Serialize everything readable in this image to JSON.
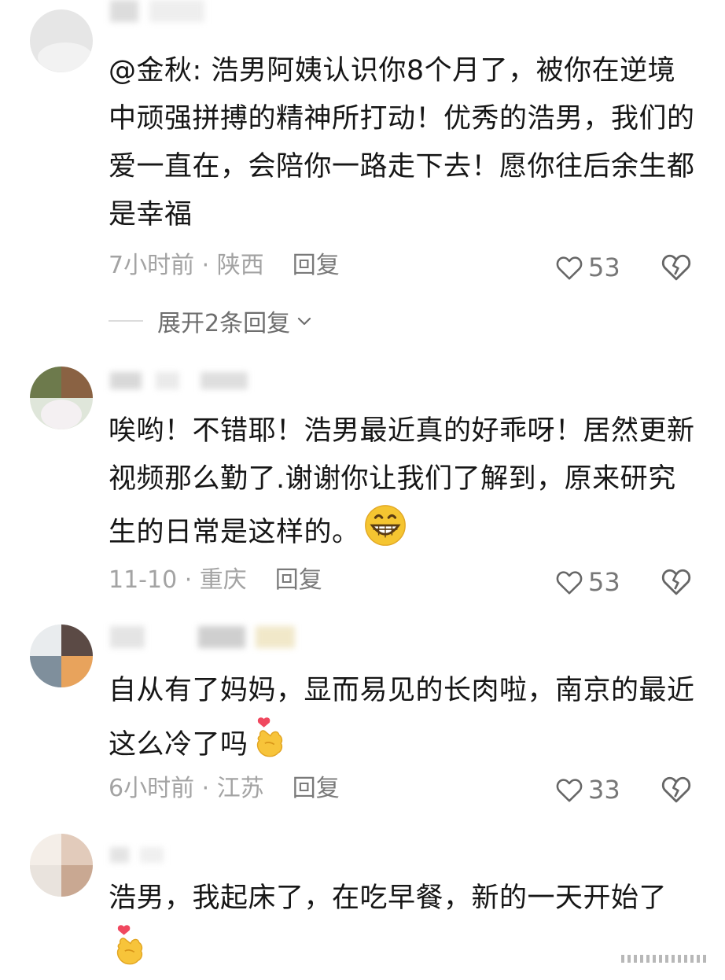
{
  "comments": [
    {
      "username": "",
      "text": "@金秋: 浩男阿姨认识你8个月了，被你在逆境中顽强拼搏的精神所打动！优秀的浩男，我们的爱一直在，会陪你一路走下去！愿你往后余生都是幸福",
      "meta": "7小时前 · 陕西",
      "reply_label": "回复",
      "likes": "53",
      "expand_label": "展开2条回复"
    },
    {
      "username": "",
      "text": "唉哟！不错耶！浩男最近真的好乖呀！居然更新视频那么勤了.谢谢你让我们了解到，原来研究生的日常是这样的。",
      "meta": "11-10 · 重庆",
      "reply_label": "回复",
      "likes": "53"
    },
    {
      "username": "",
      "text": "自从有了妈妈，显而易见的长肉啦，南京的最近这么冷了吗",
      "meta": "6小时前 · 江苏",
      "reply_label": "回复",
      "likes": "33"
    },
    {
      "username": "",
      "text": "浩男，我起床了，在吃早餐，新的一天开始了"
    }
  ],
  "icons": {
    "like": "heart-outline-icon",
    "dislike": "broken-heart-icon",
    "expand": "chevron-down-icon",
    "emoji_grin": "grinning-face-emoji",
    "emoji_heart_hand": "finger-heart-emoji"
  },
  "colors": {
    "text": "#161616",
    "meta": "#a3a3a3",
    "emoji": "#f5c531"
  }
}
